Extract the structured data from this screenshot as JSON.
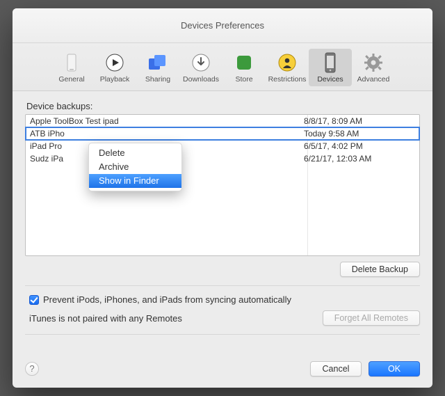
{
  "window": {
    "title": "Devices Preferences"
  },
  "toolbar": {
    "items": [
      {
        "label": "General"
      },
      {
        "label": "Playback"
      },
      {
        "label": "Sharing"
      },
      {
        "label": "Downloads"
      },
      {
        "label": "Store"
      },
      {
        "label": "Restrictions"
      },
      {
        "label": "Devices"
      },
      {
        "label": "Advanced"
      }
    ],
    "active_index": 6
  },
  "section_label": "Device backups:",
  "backups": [
    {
      "name": "Apple ToolBox Test ipad",
      "date": "8/8/17, 8:09 AM"
    },
    {
      "name": "ATB iPho",
      "date": "Today 9:58 AM"
    },
    {
      "name": "iPad Pro",
      "date": "6/5/17, 4:02 PM"
    },
    {
      "name": "Sudz iPa",
      "date": "6/21/17, 12:03 AM"
    }
  ],
  "selected_index": 1,
  "context_menu": {
    "items": [
      "Delete",
      "Archive",
      "Show in Finder"
    ],
    "hover_index": 2
  },
  "buttons": {
    "delete_backup": "Delete Backup",
    "forget_remotes": "Forget All Remotes",
    "cancel": "Cancel",
    "ok": "OK"
  },
  "checkbox": {
    "prevent_sync": "Prevent iPods, iPhones, and iPads from syncing automatically",
    "checked": true
  },
  "remote_status": "iTunes is not paired with any Remotes",
  "help_glyph": "?"
}
